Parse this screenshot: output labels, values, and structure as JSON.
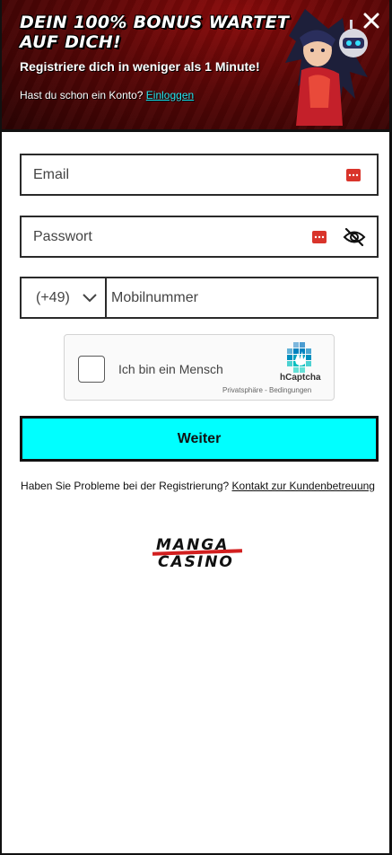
{
  "banner": {
    "title": "DEIN 100% BONUS WARTET AUF DICH!",
    "subtitle": "Registriere dich in weniger als 1 Minute!",
    "login_prompt": "Hast du schon ein Konto?",
    "login_link": "Einloggen"
  },
  "form": {
    "email_placeholder": "Email",
    "password_placeholder": "Passwort",
    "country_code": "(+49)",
    "phone_placeholder": "Mobilnummer",
    "submit_label": "Weiter"
  },
  "captcha": {
    "label": "Ich bin ein Mensch",
    "brand": "hCaptcha",
    "legal": "Privatsphäre - Bedingungen"
  },
  "help": {
    "text": "Haben Sie Probleme bei der Registrierung?",
    "link": "Kontakt zur Kundenbetreuung"
  },
  "logo": {
    "line1": "MANGA",
    "line2": "CASINO"
  },
  "colors": {
    "accent": "#00ffff",
    "banner": "#6b0808",
    "link": "#25e6f0",
    "logo_slash": "#d21f1f"
  },
  "icons": {
    "close": "close-icon",
    "password_manager": "password-manager-icon",
    "visibility": "eye-slash-icon",
    "dropdown": "chevron-down-icon",
    "captcha": "hcaptcha-logo-icon"
  }
}
